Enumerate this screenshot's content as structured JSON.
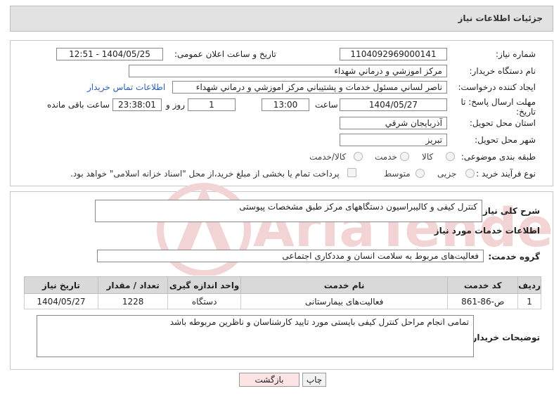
{
  "header": {
    "title": "جزئیات اطلاعات نیاز"
  },
  "need": {
    "number_label": "شماره نیاز:",
    "number": "1104092969000141",
    "announce_label": "تاریخ و ساعت اعلان عمومی:",
    "announce_value": "1404/05/25 - 12:51",
    "buyer_label": "نام دستگاه خریدار:",
    "buyer": "مرکز اموزشي و درماني شهداء",
    "creator_label": "ایجاد کننده درخواست:",
    "creator": "ناصر لساني مسئول خدمات و پشتيباني مرکز اموزشي و درماني شهداء",
    "contact_link": "اطلاعات تماس خریدار",
    "deadline_label_1": "مهلت ارسال پاسخ: تا",
    "deadline_label_2": "تاریخ:",
    "deadline_date": "1404/05/27",
    "time_label": "ساعت",
    "deadline_time": "13:00",
    "days_value": "1",
    "days_label": "روز و",
    "remain_time": "23:38:01",
    "remain_label": "ساعت باقی مانده",
    "province_label": "استان محل تحویل:",
    "province": "آذربايجان شرقي",
    "city_label": "شهر محل تحویل:",
    "city": "تبريز",
    "category_label": "طبقه بندی موضوعی:",
    "category_options": [
      "کالا",
      "خدمت",
      "کالا/خدمت"
    ],
    "process_label": "نوع فرآیند خرید :",
    "process_options": [
      "جزیی",
      "متوسط"
    ],
    "payment_note": "پرداخت تمام یا بخشی از مبلغ خرید،از محل \"اسناد خزانه اسلامی\" خواهد بود."
  },
  "description": {
    "label": "شرح کلی نیاز:",
    "text": "کنترل کيفی و کاليبراسيون دستگاههای مرکز طبق مشخصات پيوستی"
  },
  "services": {
    "section_title": "اطلاعات خدمات مورد نیاز",
    "group_label": "گروه خدمت:",
    "group_value": "فعالیت‌های مربوط به سلامت انسان و مددکاری اجتماعی",
    "columns": [
      "ردیف",
      "کد خدمت",
      "نام خدمت",
      "واحد اندازه گیری",
      "تعداد / مقدار",
      "تاریخ نیاز"
    ],
    "rows": [
      [
        "1",
        "ص-86-861",
        "فعالیت‌های بیمارستانی",
        "دستگاه",
        "1228",
        "1404/05/27"
      ]
    ]
  },
  "buyer_notes": {
    "label": "توضیحات خریدار:",
    "text": "تمامی انجام مراحل کنترل کيفی بایستی مورد تایيد کارشناسان و ناظرين مربوطه باشد"
  },
  "buttons": {
    "print": "چاپ",
    "back": "بازگشت"
  },
  "watermark": {
    "text": "AriaTender.net"
  },
  "colors": {
    "header_bg": "#e2e2e2",
    "table_header_bg": "#d9d9d9",
    "link": "#2d5db3",
    "back_button_bg": "#fde3e3",
    "watermark": "#f3d4d4"
  }
}
